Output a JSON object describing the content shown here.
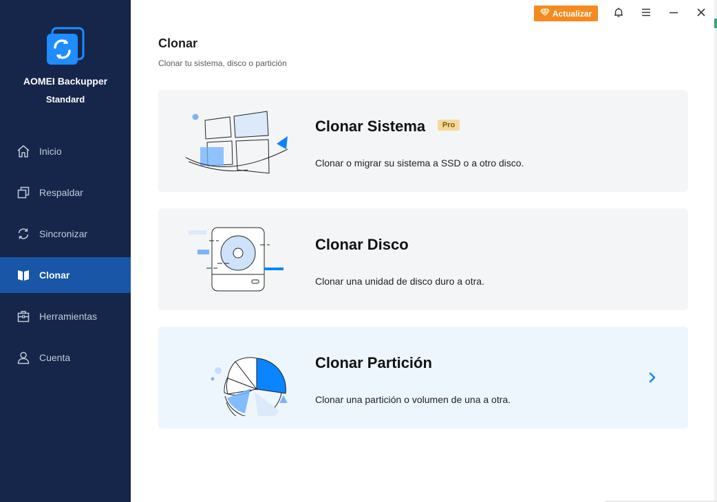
{
  "app": {
    "name": "AOMEI Backupper",
    "edition": "Standard"
  },
  "sidebar": {
    "items": [
      {
        "label": "Inicio",
        "icon": "home-icon"
      },
      {
        "label": "Respaldar",
        "icon": "copy-icon"
      },
      {
        "label": "Sincronizar",
        "icon": "sync-icon"
      },
      {
        "label": "Clonar",
        "icon": "clone-icon",
        "active": true
      },
      {
        "label": "Herramientas",
        "icon": "toolbox-icon"
      },
      {
        "label": "Cuenta",
        "icon": "user-icon"
      }
    ]
  },
  "titlebar": {
    "upgrade_label": "Actualizar",
    "icons": [
      "diamond-icon",
      "bell-icon",
      "menu-icon",
      "minimize-icon",
      "close-icon"
    ]
  },
  "page": {
    "title": "Clonar",
    "subtitle": "Clonar tu sistema, disco o partición"
  },
  "cards": [
    {
      "title": "Clonar Sistema",
      "badge": "Pro",
      "description": "Clonar o migrar su sistema a SSD o a otro disco."
    },
    {
      "title": "Clonar Disco",
      "description": "Clonar una unidad de disco duro a otra."
    },
    {
      "title": "Clonar Partición",
      "description": "Clonar una partición o volumen de una a otra."
    }
  ],
  "colors": {
    "sidebar_bg": "#15264a",
    "sidebar_active": "#1a56a8",
    "accent": "#0a84ff",
    "upgrade": "#f58a1f",
    "card_bg": "#f4f5f7",
    "card_hover_bg": "#eef6fd",
    "pro_badge": "#f6d99a"
  }
}
